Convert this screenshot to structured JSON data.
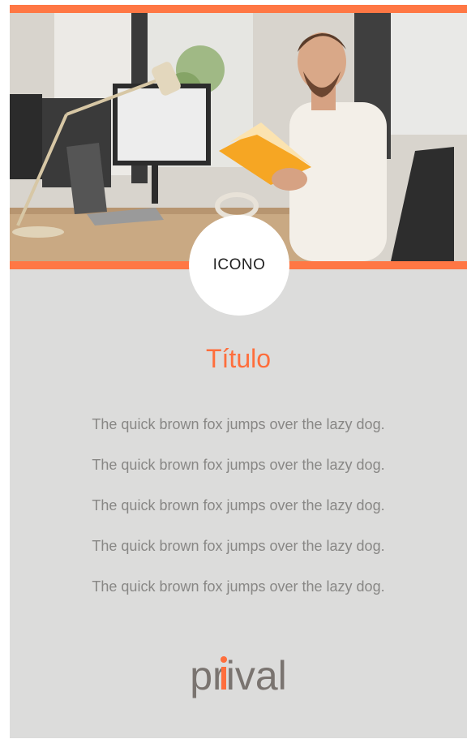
{
  "hero": {
    "image_icon": "office-photo-icon",
    "icon_label": "ICONO"
  },
  "title": "Título",
  "body_lines": [
    "The quick brown fox jumps over the lazy dog.",
    "The quick brown fox jumps over the lazy dog.",
    "The quick brown fox jumps over the lazy dog.",
    "The quick brown fox jumps over the lazy dog.",
    "The quick brown fox jumps over the lazy dog."
  ],
  "logo": {
    "text": "prival"
  },
  "colors": {
    "accent": "#ff7744",
    "background": "#dcdcdb",
    "body_text": "#888785",
    "logo_gray": "#7a7470"
  }
}
